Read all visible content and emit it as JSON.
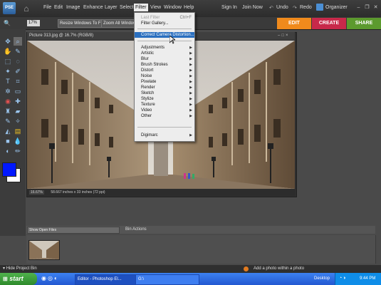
{
  "app": {
    "logo_text": "PSE"
  },
  "menubar": {
    "items": [
      "File",
      "Edit",
      "Image",
      "Enhance",
      "Layer",
      "Select",
      "Filter",
      "View",
      "Window",
      "Help"
    ],
    "sign_in": "Sign In",
    "join_now": "Join Now",
    "undo": "Undo",
    "redo": "Redo",
    "organizer": "Organizer"
  },
  "options": {
    "zoom_value": "17%",
    "resize_windows": "Resize Windows To Fit",
    "zoom_all_windows": "Zoom All Windows"
  },
  "tabs": {
    "edit": "EDIT",
    "create": "CREATE",
    "share": "SHARE"
  },
  "document": {
    "title": "Picture 313.jpg @ 16.7% (RGB/8)",
    "zoom_readout": "16.67%",
    "size_readout": "58.667 inches x 33 inches (72 ppi)"
  },
  "filter_menu": {
    "last_filter": "Last Filter",
    "last_filter_shortcut": "Ctrl+F",
    "filter_gallery": "Filter Gallery...",
    "correct_camera": "Correct Camera Distortion...",
    "submenus": [
      "Adjustments",
      "Artistic",
      "Blur",
      "Brush Strokes",
      "Distort",
      "Noise",
      "Pixelate",
      "Render",
      "Sketch",
      "Stylize",
      "Texture",
      "Video",
      "Other"
    ],
    "digimarc": "Digimarc"
  },
  "bin": {
    "show_open_files": "Show Open Files",
    "bin_actions": "Bin Actions",
    "hide_project_bin": "Hide Project Bin",
    "add_photo_tip": "Add a photo within a photo"
  },
  "taskbar": {
    "start": "start",
    "tasks": [
      "Editor - Photoshop El...",
      "G:\\"
    ],
    "desktop": "Desktop",
    "clock": "9:44 PM"
  },
  "colors": {
    "edit_tab": "#f08a1c",
    "create_tab": "#c8294a",
    "share_tab": "#5c9a2e",
    "foreground": "#0018ff",
    "background": "#ffffff"
  }
}
